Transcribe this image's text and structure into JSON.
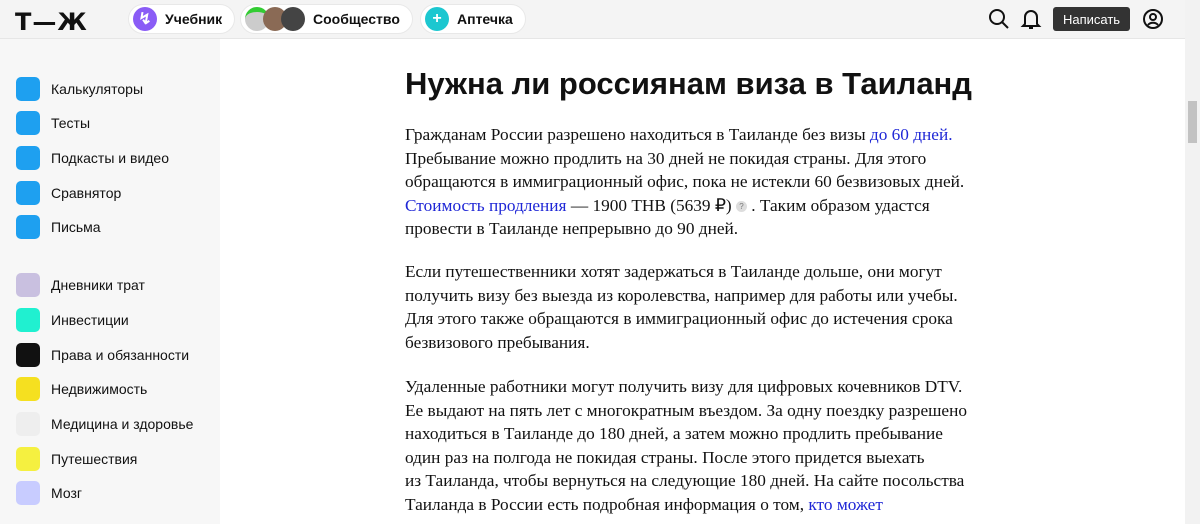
{
  "header": {
    "logo": "Т—Ж",
    "pills": [
      {
        "label": "Учебник",
        "icon": "lightning-icon",
        "color": "#8a5cf6"
      },
      {
        "label": "Сообщество",
        "icon": "community-avatars-icon"
      },
      {
        "label": "Аптечка",
        "icon": "plus-icon",
        "color": "#1cc7d0"
      }
    ],
    "write_label": "Написать"
  },
  "sidebar": {
    "groups": [
      [
        {
          "label": "Калькуляторы",
          "color": "#1ea0f0"
        },
        {
          "label": "Тесты",
          "color": "#1ea0f0"
        },
        {
          "label": "Подкасты и видео",
          "color": "#1ea0f0"
        },
        {
          "label": "Сравнятор",
          "color": "#1ea0f0"
        },
        {
          "label": "Письма",
          "color": "#1ea0f0"
        }
      ],
      [
        {
          "label": "Дневники трат",
          "color": "#c9c0e0"
        },
        {
          "label": "Инвестиции",
          "color": "#20f0d0"
        },
        {
          "label": "Права и обязанности",
          "color": "#111111"
        },
        {
          "label": "Недвижимость",
          "color": "#f5e020"
        },
        {
          "label": "Медицина и здоровье",
          "color": "#eeeeee"
        },
        {
          "label": "Путешествия",
          "color": "#f5f040"
        },
        {
          "label": "Мозг",
          "color": "#c8ccff"
        }
      ]
    ]
  },
  "article": {
    "title": "Нужна ли россиянам виза в Таиланд",
    "paragraphs": [
      [
        [
          {
            "t": "Гражданам России разрешено находиться в Таиланде без визы "
          },
          {
            "t": "до 60 дней.",
            "link": true
          }
        ],
        [
          {
            "t": "Пребывание можно продлить на 30 дней не покидая страны. Для этого"
          }
        ],
        [
          {
            "t": "обращаются в иммиграционный офис, пока не истекли 60 безвизовых дней."
          }
        ],
        [
          {
            "t": "Стоимость продления",
            "link": true
          },
          {
            "t": " — 1900 THB (5639 ₽) "
          },
          {
            "q": "?"
          },
          {
            "t": " . Таким образом удастся"
          }
        ],
        [
          {
            "t": "провести в Таиланде непрерывно до 90 дней."
          }
        ]
      ],
      [
        [
          {
            "t": "Если путешественники хотят задержаться в Таиланде дольше, они могут"
          }
        ],
        [
          {
            "t": "получить визу без выезда из королевства, например для работы или учебы."
          }
        ],
        [
          {
            "t": "Для этого также обращаются в иммиграционный офис до истечения срока"
          }
        ],
        [
          {
            "t": "безвизового пребывания."
          }
        ]
      ],
      [
        [
          {
            "t": "Удаленные работники могут получить визу для цифровых кочевников DTV."
          }
        ],
        [
          {
            "t": "Ее выдают на пять лет с многократным въездом. За одну поездку разрешено"
          }
        ],
        [
          {
            "t": "находиться в Таиланде до 180 дней, а затем можно продлить пребывание"
          }
        ],
        [
          {
            "t": "один раз на полгода не покидая страны. После этого придется выехать"
          }
        ],
        [
          {
            "t": "из Таиланда, чтобы вернуться на следующие 180 дней. На сайте посольства"
          }
        ],
        [
          {
            "t": "Таиланда в России есть подробная информация о том, "
          },
          {
            "t": "кто может",
            "link": true
          }
        ]
      ]
    ]
  }
}
